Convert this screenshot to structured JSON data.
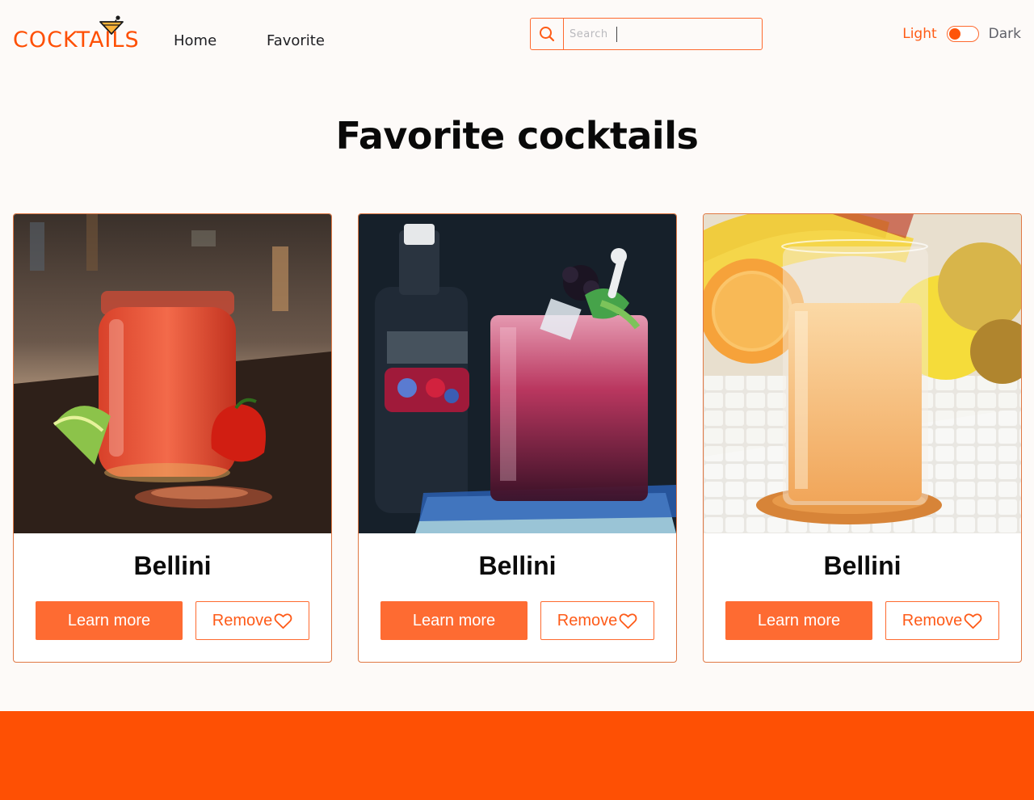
{
  "header": {
    "logo_text": "COCKTAILS",
    "nav": {
      "home": "Home",
      "favorite": "Favorite"
    },
    "search": {
      "placeholder": "Search",
      "value": ""
    },
    "theme": {
      "light_label": "Light",
      "dark_label": "Dark",
      "selected": "Light"
    }
  },
  "main": {
    "title": "Favorite cocktails",
    "cards": [
      {
        "name": "Bellini",
        "learn_label": "Learn more",
        "remove_label": "Remove",
        "image": "red-cocktail-in-jar-photo"
      },
      {
        "name": "Bellini",
        "learn_label": "Learn more",
        "remove_label": "Remove",
        "image": "blackberry-cocktail-photo"
      },
      {
        "name": "Bellini",
        "learn_label": "Learn more",
        "remove_label": "Remove",
        "image": "peach-juice-glass-photo"
      }
    ]
  },
  "icons": {
    "search": "search-icon",
    "heart": "heart-icon",
    "logo": "martini-glass-icon"
  },
  "colors": {
    "accent": "#fe5004",
    "button": "#fe6b32",
    "background": "#fdfaf8",
    "footer": "#fe5004"
  }
}
